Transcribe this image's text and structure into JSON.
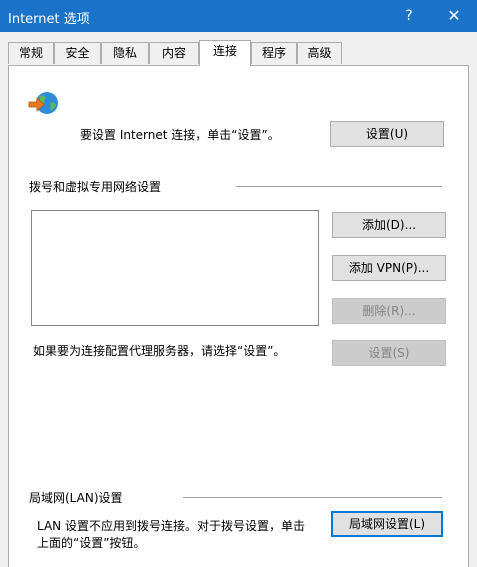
{
  "window": {
    "title": "Internet 选项",
    "help_label": "?",
    "close_label": "✕"
  },
  "tabs": [
    {
      "label": "常规"
    },
    {
      "label": "安全"
    },
    {
      "label": "隐私"
    },
    {
      "label": "内容"
    },
    {
      "label": "连接"
    },
    {
      "label": "程序"
    },
    {
      "label": "高级"
    }
  ],
  "active_tab": "连接",
  "connection": {
    "icon": "globe-network-icon",
    "setup_text": "要设置 Internet 连接，单击“设置”。",
    "setup_button": "设置(U)"
  },
  "dialup": {
    "heading": "拨号和虚拟专用网络设置",
    "add_button": "添加(D)...",
    "add_vpn_button": "添加 VPN(P)...",
    "remove_button": "删除(R)...",
    "proxy_text": "如果要为连接配置代理服务器，请选择“设置”。",
    "settings_button": "设置(S)"
  },
  "lan": {
    "heading": "局域网(LAN)设置",
    "desc_line1": "LAN 设置不应用到拨号连接。对于拨号设置，单击",
    "desc_line2": "上面的“设置”按钮。",
    "lan_button": "局域网设置(L)"
  },
  "colors": {
    "titlebar": "#1a73c9",
    "accent_focus": "#0078d7"
  }
}
